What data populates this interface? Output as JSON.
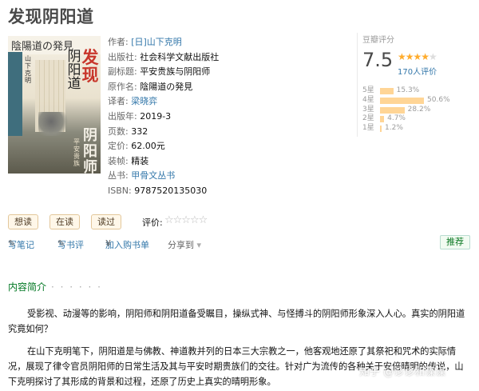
{
  "book": {
    "title": "发现阴阳道",
    "cover": {
      "top_title": "陰陽道の発見",
      "red_big": [
        "发",
        "现"
      ],
      "black_vert": [
        "阴",
        "阳",
        "道"
      ],
      "author_vert": [
        "山",
        "下",
        "克",
        "明"
      ],
      "white_vert": [
        "阴",
        "阳",
        "师"
      ],
      "sub_vert": [
        "平",
        "安",
        "贵",
        "族"
      ]
    }
  },
  "info": {
    "author_label": "作者:",
    "author": "[日]山下克明",
    "publisher_label": "出版社:",
    "publisher": "社会科学文献出版社",
    "subtitle_label": "副标题:",
    "subtitle": "平安贵族与阴阳师",
    "original_label": "原作名:",
    "original": "陰陽道の発見",
    "translator_label": "译者:",
    "translator": "梁晓弈",
    "year_label": "出版年:",
    "year": "2019-3",
    "pages_label": "页数:",
    "pages": "332",
    "price_label": "定价:",
    "price": "62.00元",
    "binding_label": "装帧:",
    "binding": "精装",
    "series_label": "丛书:",
    "series": "甲骨文丛书",
    "isbn_label": "ISBN:",
    "isbn": "9787520135030"
  },
  "rating": {
    "header": "豆瓣评分",
    "score": "7.5",
    "stars": 4,
    "count": "170人评价",
    "rows": [
      {
        "label": "5星",
        "pct": "15.3%",
        "value": 15.3
      },
      {
        "label": "4星",
        "pct": "50.6%",
        "value": 50.6
      },
      {
        "label": "3星",
        "pct": "28.2%",
        "value": 28.2
      },
      {
        "label": "2星",
        "pct": "4.7%",
        "value": 4.7
      },
      {
        "label": "1星",
        "pct": "1.2%",
        "value": 1.2
      }
    ]
  },
  "actions": {
    "want_read": "想读",
    "reading": "在读",
    "read": "读过",
    "rate_label": "评价:",
    "rate_stars": "☆☆☆☆☆"
  },
  "links": {
    "write_note": "写笔记",
    "write_review": "写书评",
    "add_cart": "加入购书单",
    "share": "分享到",
    "recommend": "推荐"
  },
  "section": {
    "title": "内容简介",
    "dots": "· · · · · ·"
  },
  "content": {
    "p1": "受影视、动漫等的影响，阴阳师和阴阳道备受瞩目，操纵式神、与怪搏斗的阴阳师形象深入人心。真实的阴阳道究竟如何？",
    "p2": "在山下克明笔下，阴阳道是与佛教、神道教并列的日本三大宗教之一，他客观地还原了其祭祀和咒术的实际情况，展现了律令官员阴阳师的日常生活及其与平安时期贵族们的交往。针对广为流传的各种关于安倍晴明的传说，山下克明探讨了其形成的背景和过程，还原了历史上真实的晴明形象。"
  },
  "watermark": "知乎 @诊诊和谋谋",
  "colors": {
    "link": "#3377aa",
    "star": "#ffac2d",
    "bar": "#ffd596",
    "section": "#007722"
  }
}
